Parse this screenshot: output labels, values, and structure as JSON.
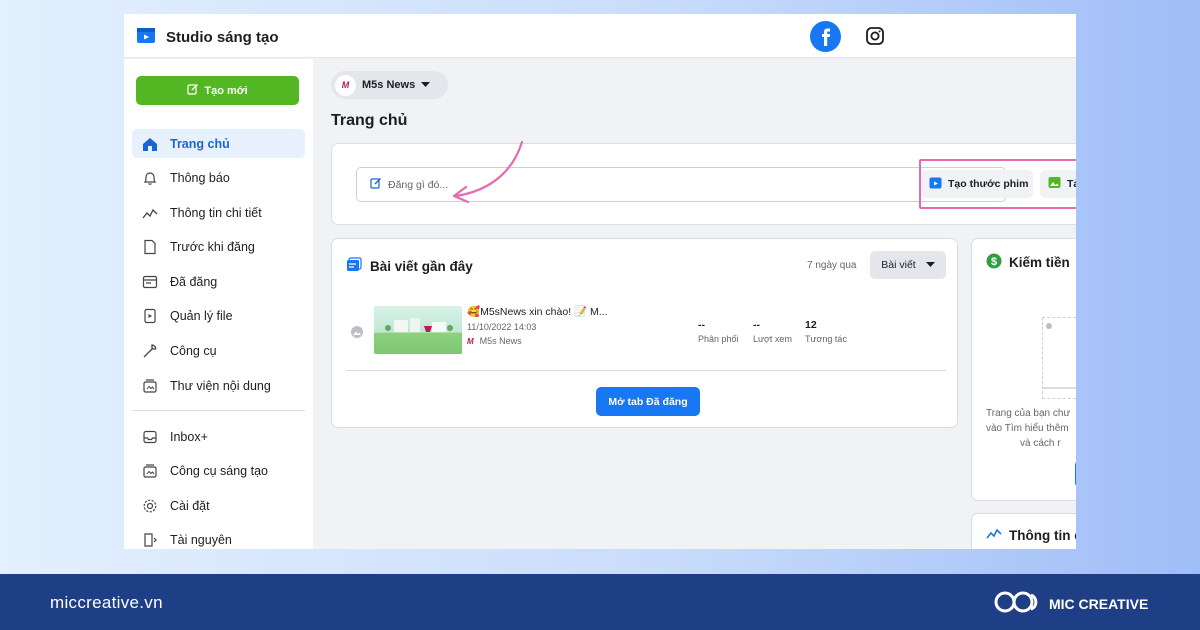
{
  "app": {
    "title": "Studio sáng tạo"
  },
  "topbar": {
    "icons": [
      "facebook-icon",
      "instagram-icon"
    ]
  },
  "sidebar": {
    "create_label": "Tạo mới",
    "items": [
      {
        "label": "Trang chủ",
        "icon": "home-icon",
        "active": true
      },
      {
        "label": "Thông báo",
        "icon": "bell-icon"
      },
      {
        "label": "Thông tin chi tiết",
        "icon": "insights-icon"
      },
      {
        "label": "Trước khi đăng",
        "icon": "draft-icon"
      },
      {
        "label": "Đã đăng",
        "icon": "published-icon"
      },
      {
        "label": "Quản lý file",
        "icon": "file-icon"
      },
      {
        "label": "Công cụ",
        "icon": "tools-icon"
      },
      {
        "label": "Thư viện nội dung",
        "icon": "library-icon"
      }
    ],
    "secondary_items": [
      {
        "label": "Inbox+",
        "icon": "inbox-icon"
      },
      {
        "label": "Công cụ sáng tạo",
        "icon": "creative-tools-icon"
      },
      {
        "label": "Cài đặt",
        "icon": "gear-icon"
      },
      {
        "label": "Tài nguyên",
        "icon": "resources-icon"
      }
    ]
  },
  "main": {
    "page_name": "M5s News",
    "page_title": "Trang chủ",
    "composer": {
      "placeholder": "Đăng gì đó...",
      "actions": [
        "Tạo thước phim",
        "Tả"
      ]
    },
    "recent_posts": {
      "title": "Bài viết gần đây",
      "period": "7 ngày qua",
      "type_filter": "Bài viết",
      "posts": [
        {
          "caption": "🥰M5sNews xin chào! 📝 M...",
          "date": "11/10/2022 14:03",
          "page": "M5s News",
          "reach_value": "--",
          "reach_label": "Phân phối",
          "views_value": "--",
          "views_label": "Lượt xem",
          "engagement_value": "12",
          "engagement_label": "Tương tác"
        }
      ],
      "open_tab_label": "Mở tab Đã đăng"
    },
    "monetize": {
      "title": "Kiếm tiền",
      "text_lines": [
        "Trang của bạn chư",
        "vào Tìm hiểu thêm",
        "và cách r"
      ]
    },
    "insights": {
      "title": "Thông tin c"
    }
  },
  "footer": {
    "site": "miccreative.vn",
    "brand": "MIC CREATIVE"
  },
  "colors": {
    "accent_blue": "#1877f2",
    "create_green": "#52b723",
    "highlight_pink": "#e56ab2",
    "footer_navy": "#1e3f85"
  }
}
